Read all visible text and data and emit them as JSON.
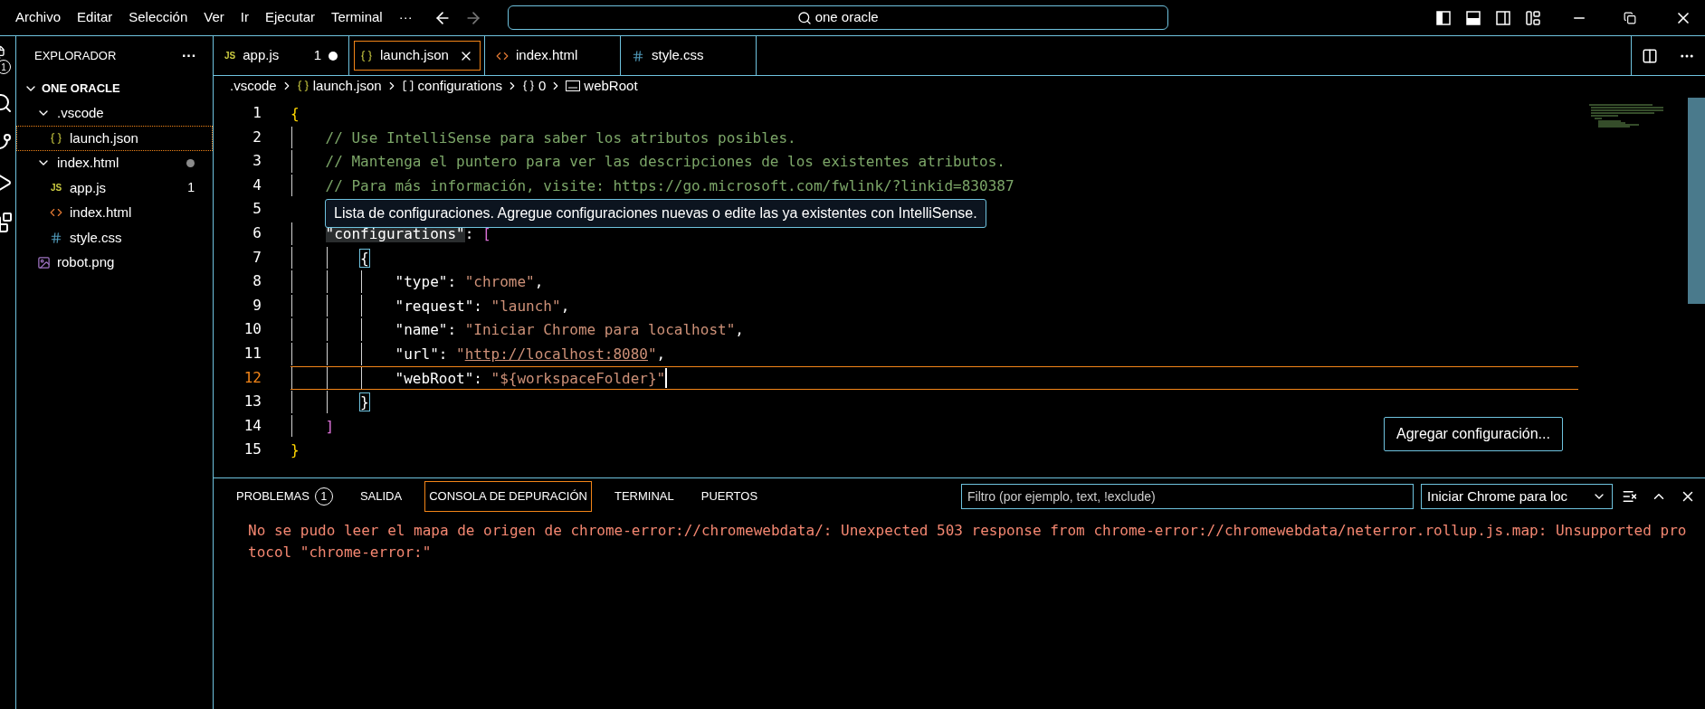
{
  "menu": [
    "Archivo",
    "Editar",
    "Selección",
    "Ver",
    "Ir",
    "Ejecutar",
    "Terminal",
    "···"
  ],
  "search": {
    "value": "one oracle"
  },
  "activity": {
    "badge": "1"
  },
  "sidebar": {
    "title": "EXPLORADOR",
    "more": "···",
    "root": {
      "label": "ONE ORACLE",
      "expanded": true
    },
    "items": [
      {
        "label": ".vscode",
        "kind": "folder",
        "expanded": true,
        "selected": false,
        "modified": false,
        "children": [
          {
            "label": "launch.json",
            "kind": "json",
            "selected": true,
            "modified": false
          }
        ]
      },
      {
        "label": "index.html",
        "kind": "folder",
        "expanded": true,
        "selected": false,
        "modified": true,
        "children": [
          {
            "label": "app.js",
            "kind": "js",
            "icon_text": "JS",
            "selected": false,
            "modified": false,
            "badge": "1"
          },
          {
            "label": "index.html",
            "kind": "html",
            "selected": false,
            "modified": false
          },
          {
            "label": "style.css",
            "kind": "css",
            "selected": false,
            "modified": false
          }
        ]
      },
      {
        "label": "robot.png",
        "kind": "image",
        "selected": false,
        "modified": false
      }
    ]
  },
  "tabs": [
    {
      "label": "app.js",
      "kind": "js",
      "icon_text": "JS",
      "selected": false,
      "modified": true,
      "badge": "1"
    },
    {
      "label": "launch.json",
      "kind": "json",
      "selected": true,
      "modified": false
    },
    {
      "label": "index.html",
      "kind": "html",
      "selected": false,
      "modified": false
    },
    {
      "label": "style.css",
      "kind": "css",
      "selected": false,
      "modified": false
    }
  ],
  "breadcrumb": [
    {
      "label": ".vscode",
      "kind": "folder"
    },
    {
      "label": "launch.json",
      "kind": "json"
    },
    {
      "label": "configurations",
      "kind": "array"
    },
    {
      "label": "0",
      "kind": "object"
    },
    {
      "label": "webRoot",
      "kind": "string"
    }
  ],
  "lines": [
    {
      "number": "1",
      "current": false,
      "tokens": [
        {
          "kind": "brace",
          "text": "{"
        }
      ]
    },
    {
      "number": "2",
      "current": false,
      "tokens": [
        {
          "kind": "comment",
          "text": "    // Use IntelliSense para saber los atributos posibles."
        }
      ]
    },
    {
      "number": "3",
      "current": false,
      "tokens": [
        {
          "kind": "comment",
          "text": "    // Mantenga el puntero para ver las descripciones de los existentes atributos."
        }
      ]
    },
    {
      "number": "4",
      "current": false,
      "tokens": [
        {
          "kind": "comment",
          "text": "    // Para más información, visite: https://go.microsoft.com/fwlink/?linkid=830387"
        }
      ]
    },
    {
      "number": "5",
      "current": false
    },
    {
      "number": "6",
      "current": false,
      "tokens": [
        {
          "kind": "hover-key",
          "text": "    \"configurations\""
        },
        {
          "kind": "punct",
          "text": ": "
        },
        {
          "kind": "bracket",
          "text": "["
        }
      ]
    },
    {
      "number": "7",
      "current": false,
      "tokens": [
        {
          "kind": "match",
          "text": "        {"
        }
      ]
    },
    {
      "number": "8",
      "current": false,
      "tokens": [
        {
          "kind": "key",
          "text": "            \"type\""
        },
        {
          "kind": "punct",
          "text": ": "
        },
        {
          "kind": "string",
          "text": "\"chrome\""
        },
        {
          "kind": "punct",
          "text": ","
        }
      ]
    },
    {
      "number": "9",
      "current": false,
      "tokens": [
        {
          "kind": "key",
          "text": "            \"request\""
        },
        {
          "kind": "punct",
          "text": ": "
        },
        {
          "kind": "string",
          "text": "\"launch\""
        },
        {
          "kind": "punct",
          "text": ","
        }
      ]
    },
    {
      "number": "10",
      "current": false,
      "tokens": [
        {
          "kind": "key",
          "text": "            \"name\""
        },
        {
          "kind": "punct",
          "text": ": "
        },
        {
          "kind": "string",
          "text": "\"Iniciar Chrome para localhost\""
        },
        {
          "kind": "punct",
          "text": ","
        }
      ]
    },
    {
      "number": "11",
      "current": false,
      "tokens": [
        {
          "kind": "key",
          "text": "            \"url\""
        },
        {
          "kind": "punct",
          "text": ": "
        },
        {
          "kind": "string",
          "text": "\""
        },
        {
          "kind": "link",
          "text": "http://localhost:8080"
        },
        {
          "kind": "string",
          "text": "\""
        },
        {
          "kind": "punct",
          "text": ","
        }
      ]
    },
    {
      "number": "12",
      "current": true,
      "tokens": [
        {
          "kind": "key",
          "text": "            \"webRoot\""
        },
        {
          "kind": "punct",
          "text": ": "
        },
        {
          "kind": "string",
          "text": "\"${workspaceFolder}\""
        }
      ]
    },
    {
      "number": "13",
      "current": false,
      "tokens": [
        {
          "kind": "match",
          "text": "        }"
        }
      ]
    },
    {
      "number": "14",
      "current": false,
      "tokens": [
        {
          "kind": "bracket",
          "text": "    ]"
        }
      ]
    },
    {
      "number": "15",
      "current": false,
      "tokens": [
        {
          "kind": "brace",
          "text": "}"
        }
      ]
    }
  ],
  "tooltip": "Lista de configuraciones. Agregue configuraciones nuevas o edite las ya existentes con IntelliSense.",
  "add_button": "Agregar configuración...",
  "panel": {
    "tabs": [
      {
        "label": "PROBLEMAS",
        "selected": false,
        "badge": "1"
      },
      {
        "label": "SALIDA",
        "selected": false
      },
      {
        "label": "CONSOLA DE DEPURACIÓN",
        "selected": true
      },
      {
        "label": "TERMINAL",
        "selected": false
      },
      {
        "label": "PUERTOS",
        "selected": false
      }
    ],
    "filter": {
      "placeholder": "Filtro (por ejemplo, text, !exclude)"
    },
    "session": "Iniciar Chrome para loc",
    "output": [
      {
        "kind": "error",
        "text": "No se pudo leer el mapa de origen de chrome-error://chromewebdata/: Unexpected 503 response from chrome-error://chromewebdata/neterror.rollup.js.map: Unsupported protocol \"chrome-error:\""
      }
    ]
  }
}
